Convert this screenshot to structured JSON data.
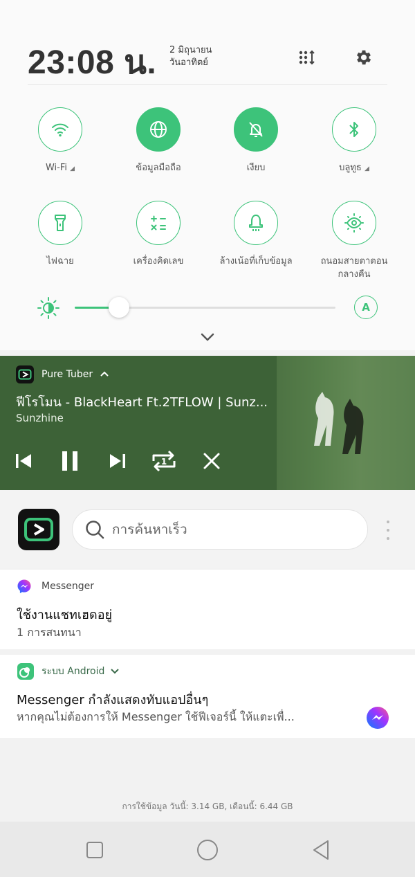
{
  "status": {
    "time": "23:08 น.",
    "date_line1": "2 มิถุนายน",
    "date_line2": "วันอาทิตย์"
  },
  "quick_tiles": [
    {
      "label": "Wi-Fi",
      "icon": "wifi-icon",
      "active": false,
      "has_arrow": true
    },
    {
      "label": "ข้อมูลมือถือ",
      "icon": "globe-icon",
      "active": true,
      "has_arrow": false
    },
    {
      "label": "เงียบ",
      "icon": "bell-off-icon",
      "active": true,
      "has_arrow": false
    },
    {
      "label": "บลูทูธ",
      "icon": "bluetooth-icon",
      "active": false,
      "has_arrow": true
    },
    {
      "label": "ไฟฉาย",
      "icon": "flashlight-icon",
      "active": false,
      "has_arrow": false
    },
    {
      "label": "เครื่องคิดเลข",
      "icon": "calculator-icon",
      "active": false,
      "has_arrow": false
    },
    {
      "label": "ล้างเน้อที่เก็บข้อมูล",
      "icon": "clean-storage-icon",
      "active": false,
      "has_arrow": false
    },
    {
      "label": "ถนอมสายตาตอนกลางคืน",
      "label_line1": "ถนอมสายตาตอน",
      "label_line2": "กลางคืน",
      "icon": "eye-comfort-icon",
      "active": false,
      "has_arrow": false
    }
  ],
  "brightness": {
    "level": 0.17,
    "auto_label": "A"
  },
  "media": {
    "app_name": "Pure Tuber",
    "title": "ฟีโรโมน - BlackHeart Ft.2TFLOW | Sunz...",
    "artist": "Sunzhine"
  },
  "search": {
    "placeholder": "การค้นหาเร็ว"
  },
  "notifications": [
    {
      "app": "Messenger",
      "title": "ใช้งานแชทเฮดอยู่",
      "text": "1 การสนทนา"
    },
    {
      "app": "ระบบ Android",
      "title": "Messenger กำลังแสดงทับแอปอื่นๆ",
      "text": "หากคุณไม่ต้องการให้ Messenger ใช้ฟีเจอร์นี้ ให้แตะเพื่..."
    }
  ],
  "data_usage": "การใช้ข้อมูล วันนี้: 3.14 GB, เดือนนี้: 6.44 GB",
  "colors": {
    "accent": "#3dc37a",
    "media_bg": "#3d6237",
    "messenger": "#7b4dff",
    "android": "#3dc37a"
  }
}
